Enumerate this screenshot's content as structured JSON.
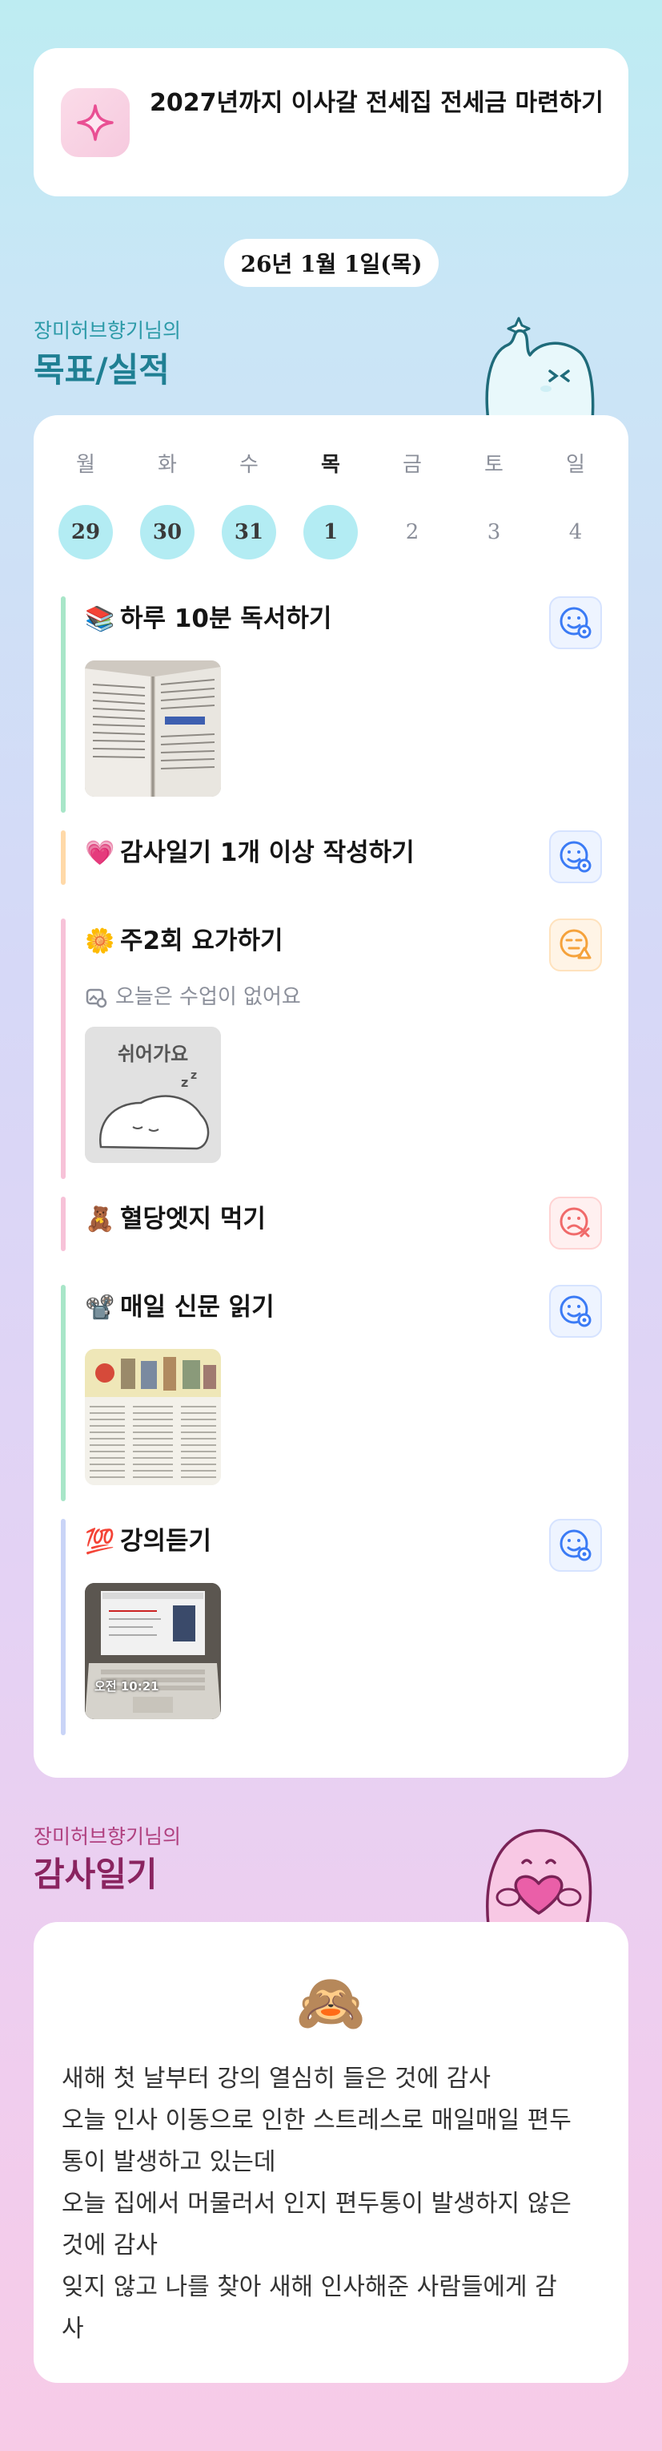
{
  "goal": {
    "icon": "sparkle-icon",
    "title": "2027년까지 이사갈 전세집 전세금 마련하기"
  },
  "date_label": "26년 1월 1일(목)",
  "goals_section": {
    "subtitle": "장미허브향기님의",
    "title": "목표/실적"
  },
  "week": [
    {
      "day": "월",
      "date": "29",
      "state": "filled"
    },
    {
      "day": "화",
      "date": "30",
      "state": "filled"
    },
    {
      "day": "수",
      "date": "31",
      "state": "filled"
    },
    {
      "day": "목",
      "date": "1",
      "state": "filled",
      "today": true
    },
    {
      "day": "금",
      "date": "2",
      "state": "empty"
    },
    {
      "day": "토",
      "date": "3",
      "state": "empty"
    },
    {
      "day": "일",
      "date": "4",
      "state": "empty"
    }
  ],
  "goals": [
    {
      "emoji": "📚",
      "label": "하루 10분 독서하기",
      "status": "done",
      "bar_color": "#a8e6c8",
      "image": "book-photo"
    },
    {
      "emoji": "💗",
      "label": "감사일기 1개 이상 작성하기",
      "status": "done",
      "bar_color": "#ffd9a8",
      "image": null
    },
    {
      "emoji": "🌼",
      "label": "주2회 요가하기",
      "status": "partial",
      "bar_color": "#f7c2d8",
      "note": "오늘은 수업이 없어요",
      "image": "rest-illustration",
      "image_text": "쉬어가요"
    },
    {
      "emoji": "🧸",
      "label": "혈당엣지 먹기",
      "status": "failed",
      "bar_color": "#f7c2d8",
      "image": null
    },
    {
      "emoji": "📽️",
      "label": "매일 신문 읽기",
      "status": "done",
      "bar_color": "#a8e6c8",
      "image": "newspaper-photo"
    },
    {
      "emoji": "💯",
      "label": "강의듣기",
      "status": "done",
      "bar_color": "#c9d4f7",
      "image": "laptop-photo",
      "image_text": "오전 10:21"
    }
  ],
  "status_colors": {
    "done": "#3b7bf5",
    "partial": "#f5a23b",
    "failed": "#f06a6a"
  },
  "grat_section": {
    "subtitle": "장미허브향기님의",
    "title": "감사일기"
  },
  "gratitude": {
    "emoji": "🙈",
    "lines": [
      "새해 첫 날부터 강의 열심히 들은 것에 감사",
      "오늘 인사 이동으로 인한 스트레스로 매일매일 편두",
      "통이 발생하고 있는데",
      "오늘 집에서 머물러서 인지 편두통이 발생하지 않은",
      "것에 감사",
      "잊지 않고 나를 찾아 새해 인사해준 사람들에게 감",
      "사"
    ]
  }
}
